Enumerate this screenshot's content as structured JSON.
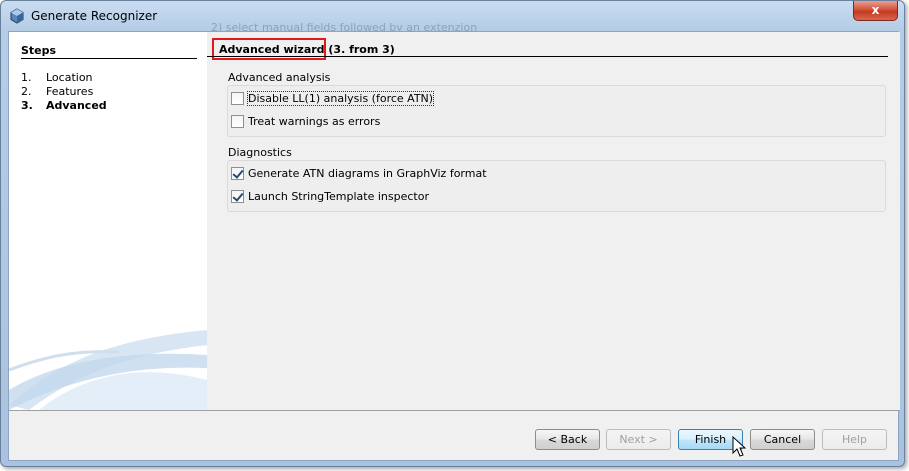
{
  "window": {
    "title": "Generate Recognizer",
    "background_text": "2) select manual fields followed by an extenzion",
    "close_label": "x"
  },
  "steps": {
    "heading": "Steps",
    "items": [
      {
        "num": "1.",
        "label": "Location",
        "current": false
      },
      {
        "num": "2.",
        "label": "Features",
        "current": false
      },
      {
        "num": "3.",
        "label": "Advanced",
        "current": true
      }
    ]
  },
  "header": {
    "title": "Advanced wizard",
    "suffix": " (3. from 3)"
  },
  "groups": {
    "analysis": {
      "label": "Advanced analysis",
      "options": [
        {
          "label": "Disable LL(1) analysis (force ATN)",
          "checked": false
        },
        {
          "label": "Treat warnings as errors",
          "checked": false
        }
      ]
    },
    "diagnostics": {
      "label": "Diagnostics",
      "options": [
        {
          "label": "Generate ATN diagrams in GraphViz format",
          "checked": true
        },
        {
          "label": "Launch StringTemplate inspector",
          "checked": true
        }
      ]
    }
  },
  "buttons": {
    "back": "< Back",
    "next": "Next >",
    "finish": "Finish",
    "cancel": "Cancel",
    "help": "Help"
  },
  "colors": {
    "highlight": "#e01a1a",
    "title_bar": "#b6cde6",
    "close_button": "#c23a22"
  },
  "icons": {
    "app": "netbeans-cube-icon",
    "close": "close-icon",
    "cursor": "mouse-pointer-icon"
  }
}
